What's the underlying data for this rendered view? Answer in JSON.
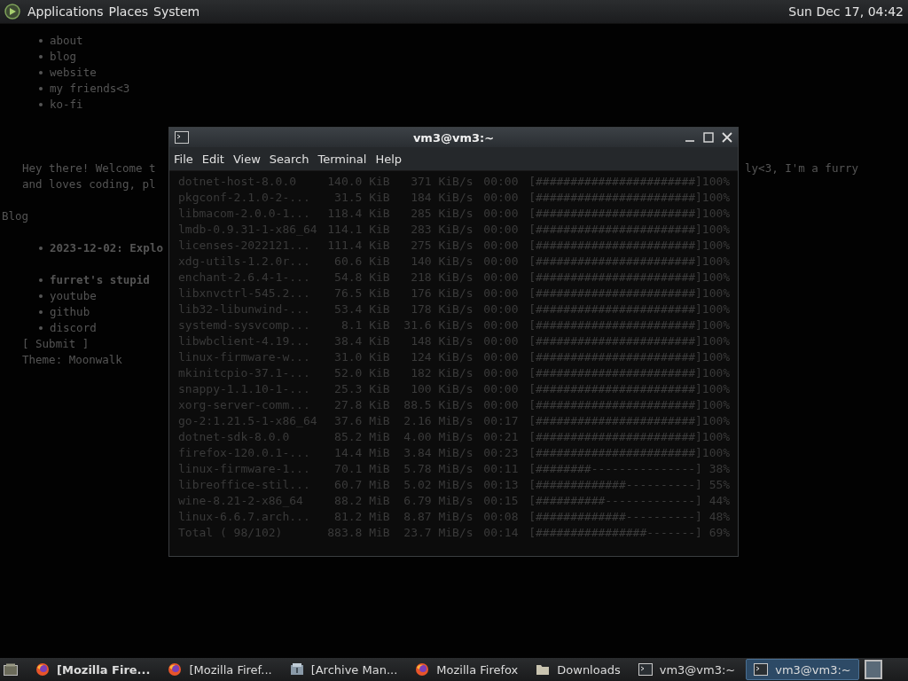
{
  "top_panel": {
    "menus": [
      "Applications",
      "Places",
      "System"
    ],
    "clock": "Sun Dec 17, 04:42"
  },
  "background_page": {
    "links": [
      "about",
      "blog",
      "website",
      "my friends<3",
      "ko-fi"
    ],
    "intro": [
      "Hey there! Welcome t",
      "and loves coding, pl"
    ],
    "intro_right": "ly<3, I'm a furry",
    "heading": "Blog",
    "posts": [
      "2023-12-02: Explo"
    ],
    "socials_title": "furret's stupid",
    "socials": [
      "youtube",
      "github",
      "discord"
    ],
    "submit": "[ Submit ]",
    "theme": "Theme: Moonwalk"
  },
  "terminal": {
    "title": "vm3@vm3:~",
    "menu": [
      "File",
      "Edit",
      "View",
      "Search",
      "Terminal",
      "Help"
    ],
    "rows": [
      {
        "name": "dotnet-host-8.0.0",
        "size": "140.0 KiB",
        "speed": "371 KiB/s",
        "eta": "00:00",
        "bar": "[#######################]",
        "percent": "100%"
      },
      {
        "name": "pkgconf-2.1.0-2-...",
        "size": "31.5 KiB",
        "speed": "184 KiB/s",
        "eta": "00:00",
        "bar": "[#######################]",
        "percent": "100%"
      },
      {
        "name": "libmacom-2.0.0-1...",
        "size": "118.4 KiB",
        "speed": "285 KiB/s",
        "eta": "00:00",
        "bar": "[#######################]",
        "percent": "100%"
      },
      {
        "name": "lmdb-0.9.31-1-x86_64",
        "size": "114.1 KiB",
        "speed": "283 KiB/s",
        "eta": "00:00",
        "bar": "[#######################]",
        "percent": "100%"
      },
      {
        "name": "licenses-2022121...",
        "size": "111.4 KiB",
        "speed": "275 KiB/s",
        "eta": "00:00",
        "bar": "[#######################]",
        "percent": "100%"
      },
      {
        "name": "xdg-utils-1.2.0r...",
        "size": "60.6 KiB",
        "speed": "140 KiB/s",
        "eta": "00:00",
        "bar": "[#######################]",
        "percent": "100%"
      },
      {
        "name": "enchant-2.6.4-1-...",
        "size": "54.8 KiB",
        "speed": "218 KiB/s",
        "eta": "00:00",
        "bar": "[#######################]",
        "percent": "100%"
      },
      {
        "name": "libxnvctrl-545.2...",
        "size": "76.5 KiB",
        "speed": "176 KiB/s",
        "eta": "00:00",
        "bar": "[#######################]",
        "percent": "100%"
      },
      {
        "name": "lib32-libunwind-...",
        "size": "53.4 KiB",
        "speed": "178 KiB/s",
        "eta": "00:00",
        "bar": "[#######################]",
        "percent": "100%"
      },
      {
        "name": "systemd-sysvcomp...",
        "size": "8.1 KiB",
        "speed": "31.6 KiB/s",
        "eta": "00:00",
        "bar": "[#######################]",
        "percent": "100%"
      },
      {
        "name": "libwbclient-4.19...",
        "size": "38.4 KiB",
        "speed": "148 KiB/s",
        "eta": "00:00",
        "bar": "[#######################]",
        "percent": "100%"
      },
      {
        "name": "linux-firmware-w...",
        "size": "31.0 KiB",
        "speed": "124 KiB/s",
        "eta": "00:00",
        "bar": "[#######################]",
        "percent": "100%"
      },
      {
        "name": "mkinitcpio-37.1-...",
        "size": "52.0 KiB",
        "speed": "182 KiB/s",
        "eta": "00:00",
        "bar": "[#######################]",
        "percent": "100%"
      },
      {
        "name": "snappy-1.1.10-1-...",
        "size": "25.3 KiB",
        "speed": "100 KiB/s",
        "eta": "00:00",
        "bar": "[#######################]",
        "percent": "100%"
      },
      {
        "name": "xorg-server-comm...",
        "size": "27.8 KiB",
        "speed": "88.5 KiB/s",
        "eta": "00:00",
        "bar": "[#######################]",
        "percent": "100%"
      },
      {
        "name": "go-2:1.21.5-1-x86_64",
        "size": "37.6 MiB",
        "speed": "2.16 MiB/s",
        "eta": "00:17",
        "bar": "[#######################]",
        "percent": "100%"
      },
      {
        "name": "dotnet-sdk-8.0.0",
        "size": "85.2 MiB",
        "speed": "4.00 MiB/s",
        "eta": "00:21",
        "bar": "[#######################]",
        "percent": "100%"
      },
      {
        "name": "firefox-120.0.1-...",
        "size": "14.4 MiB",
        "speed": "3.84 MiB/s",
        "eta": "00:23",
        "bar": "[#######################]",
        "percent": "100%"
      },
      {
        "name": "linux-firmware-1...",
        "size": "70.1 MiB",
        "speed": "5.78 MiB/s",
        "eta": "00:11",
        "bar": "[########---------------]",
        "percent": "38%"
      },
      {
        "name": "libreoffice-stil...",
        "size": "60.7 MiB",
        "speed": "5.02 MiB/s",
        "eta": "00:13",
        "bar": "[#############----------]",
        "percent": "55%"
      },
      {
        "name": "wine-8.21-2-x86_64",
        "size": "88.2 MiB",
        "speed": "6.79 MiB/s",
        "eta": "00:15",
        "bar": "[##########-------------]",
        "percent": "44%"
      },
      {
        "name": "linux-6.6.7.arch...",
        "size": "81.2 MiB",
        "speed": "8.87 MiB/s",
        "eta": "00:08",
        "bar": "[#############----------]",
        "percent": "48%"
      },
      {
        "name": "Total ( 98/102)",
        "size": "883.8 MiB",
        "speed": "23.7 MiB/s",
        "eta": "00:14",
        "bar": "[################-------]",
        "percent": "69%"
      }
    ]
  },
  "taskbar": {
    "items": [
      {
        "kind": "firefox",
        "label": "[Mozilla Fire...",
        "emphasized": true,
        "selected": false
      },
      {
        "kind": "firefox",
        "label": "[Mozilla Firef...",
        "emphasized": false,
        "selected": false
      },
      {
        "kind": "archive",
        "label": "[Archive Man...",
        "emphasized": false,
        "selected": false
      },
      {
        "kind": "firefox",
        "label": "Mozilla Firefox",
        "emphasized": false,
        "selected": false
      },
      {
        "kind": "folder",
        "label": "Downloads",
        "emphasized": false,
        "selected": false
      },
      {
        "kind": "terminal",
        "label": "vm3@vm3:~",
        "emphasized": false,
        "selected": false
      },
      {
        "kind": "terminal",
        "label": "vm3@vm3:~",
        "emphasized": false,
        "selected": true
      }
    ]
  }
}
